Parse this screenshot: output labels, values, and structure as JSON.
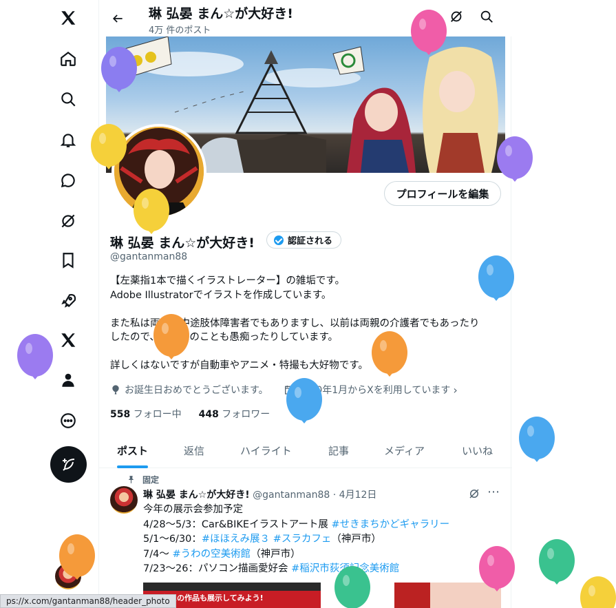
{
  "nav": {
    "items": [
      "x-logo",
      "home",
      "explore",
      "notifications",
      "messages",
      "grok",
      "bookmarks",
      "jobs",
      "premium",
      "profile",
      "more"
    ]
  },
  "header": {
    "title": "琳 弘晏 まん☆が大好き!",
    "post_count": "4万 件のポスト"
  },
  "profile": {
    "edit_button": "プロフィールを編集",
    "name": "琳 弘晏 まん☆が大好き!",
    "verified_label": "認証される",
    "handle": "@gantanman88",
    "bio": [
      "【左薬指1本で描くイラストレーター】の雑垢です。",
      "Adobe Illustratorでイラストを作成しています。",
      "",
      "また私は両上肢中途肢体障害者でもありますし、以前は両親の介護者でもあったり",
      "したので、介護系のことも愚痴ったりしています。",
      "",
      "詳しくはないですが自動車やアニメ・特撮も大好物です。"
    ],
    "birthday": "お誕生日おめでとうございます。",
    "joined": "2020年1月からXを利用しています",
    "following_count": "558",
    "following_label": "フォロー中",
    "followers_count": "448",
    "followers_label": "フォロワー"
  },
  "tabs": [
    "ポスト",
    "返信",
    "ハイライト",
    "記事",
    "メディア",
    "いいね"
  ],
  "post": {
    "pinned_label": "固定",
    "author": "琳 弘晏 まん☆が大好き!",
    "meta": "@gantanman88 · 4月12日",
    "lines": [
      {
        "text": "今年の展示会参加予定",
        "tag": "",
        "after": ""
      },
      {
        "text": "4/28〜5/3：Car&BIKEイラストアート展 ",
        "tag": "#せきまちかどギャラリー",
        "after": ""
      },
      {
        "text": "5/1〜6/30：",
        "tag": "#ほほえみ展３ #スラカフェ",
        "after": "（神戸市）"
      },
      {
        "text": "7/4〜 ",
        "tag": "#うわの空美術館",
        "after": "（神戸市）"
      },
      {
        "text": "7/23〜26：パソコン描画愛好会 ",
        "tag": "#稲沢市荻須記念美術館",
        "after": ""
      }
    ],
    "media_caption": "あなたの作品も展示してみよう!"
  },
  "status_url": "ps://x.com/gantanman88/header_photo",
  "colors": {
    "accent": "#1d9bf0",
    "text": "#0f1419",
    "muted": "#536471"
  }
}
